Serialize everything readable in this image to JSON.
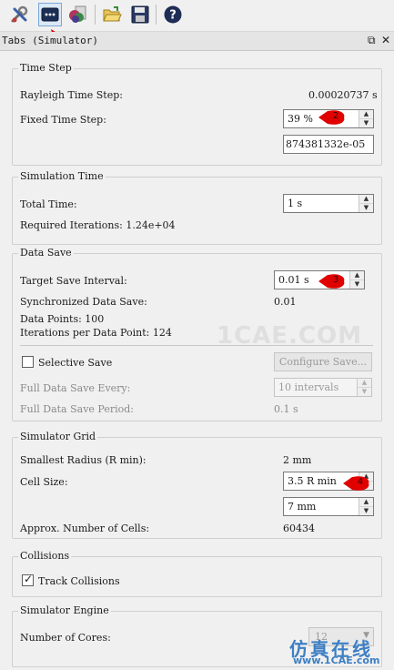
{
  "toolbar": {
    "buttons": [
      {
        "icon": "tools-icon"
      },
      {
        "icon": "simulator-tab-icon",
        "active": true
      },
      {
        "icon": "particles-icon"
      },
      {
        "icon": "open-folder-icon"
      },
      {
        "icon": "save-disk-icon"
      },
      {
        "icon": "help-icon"
      }
    ],
    "accent": "#7aa7d8"
  },
  "panel": {
    "title": "Tabs (Simulator)"
  },
  "time_step": {
    "title": "Time Step",
    "rayleigh_label": "Rayleigh Time Step:",
    "rayleigh_value": "0.00020737 s",
    "fixed_label": "Fixed Time Step:",
    "fixed_value": "39 %",
    "fixed_seconds": "874381332e-05"
  },
  "simulation_time": {
    "title": "Simulation Time",
    "total_label": "Total Time:",
    "total_value": "1 s",
    "required_text": "Required Iterations: 1.24e+04"
  },
  "data_save": {
    "title": "Data Save",
    "target_label": "Target Save Interval:",
    "target_value": "0.01 s",
    "sync_label": "Synchronized Data Save:",
    "sync_value": "0.01",
    "data_points": "Data Points: 100",
    "iterations_per_point": "Iterations per Data Point: 124",
    "selective_label": "Selective Save",
    "selective_checked": false,
    "configure_label": "Configure Save...",
    "full_every_label": "Full Data Save Every:",
    "full_every_value": "10 intervals",
    "full_period_label": "Full Data Save Period:",
    "full_period_value": "0.1 s"
  },
  "simulator_grid": {
    "title": "Simulator Grid",
    "rmin_label": "Smallest Radius (R min):",
    "rmin_value": "2 mm",
    "cell_label": "Cell Size:",
    "cell_value": "3.5 R min",
    "cell_mm": "7 mm",
    "approx_label": "Approx. Number of Cells:",
    "approx_value": "60434"
  },
  "collisions": {
    "title": "Collisions",
    "track_label": "Track Collisions",
    "track_checked": true
  },
  "engine": {
    "title": "Simulator Engine",
    "cores_label": "Number of Cores:",
    "cores_value": "12"
  },
  "markers": [
    "2",
    "3",
    "4"
  ],
  "marker_color": "#e00000",
  "watermark": "1CAE.COM",
  "brand": {
    "cn": "仿真在线",
    "url": "www.1CAE.com"
  }
}
